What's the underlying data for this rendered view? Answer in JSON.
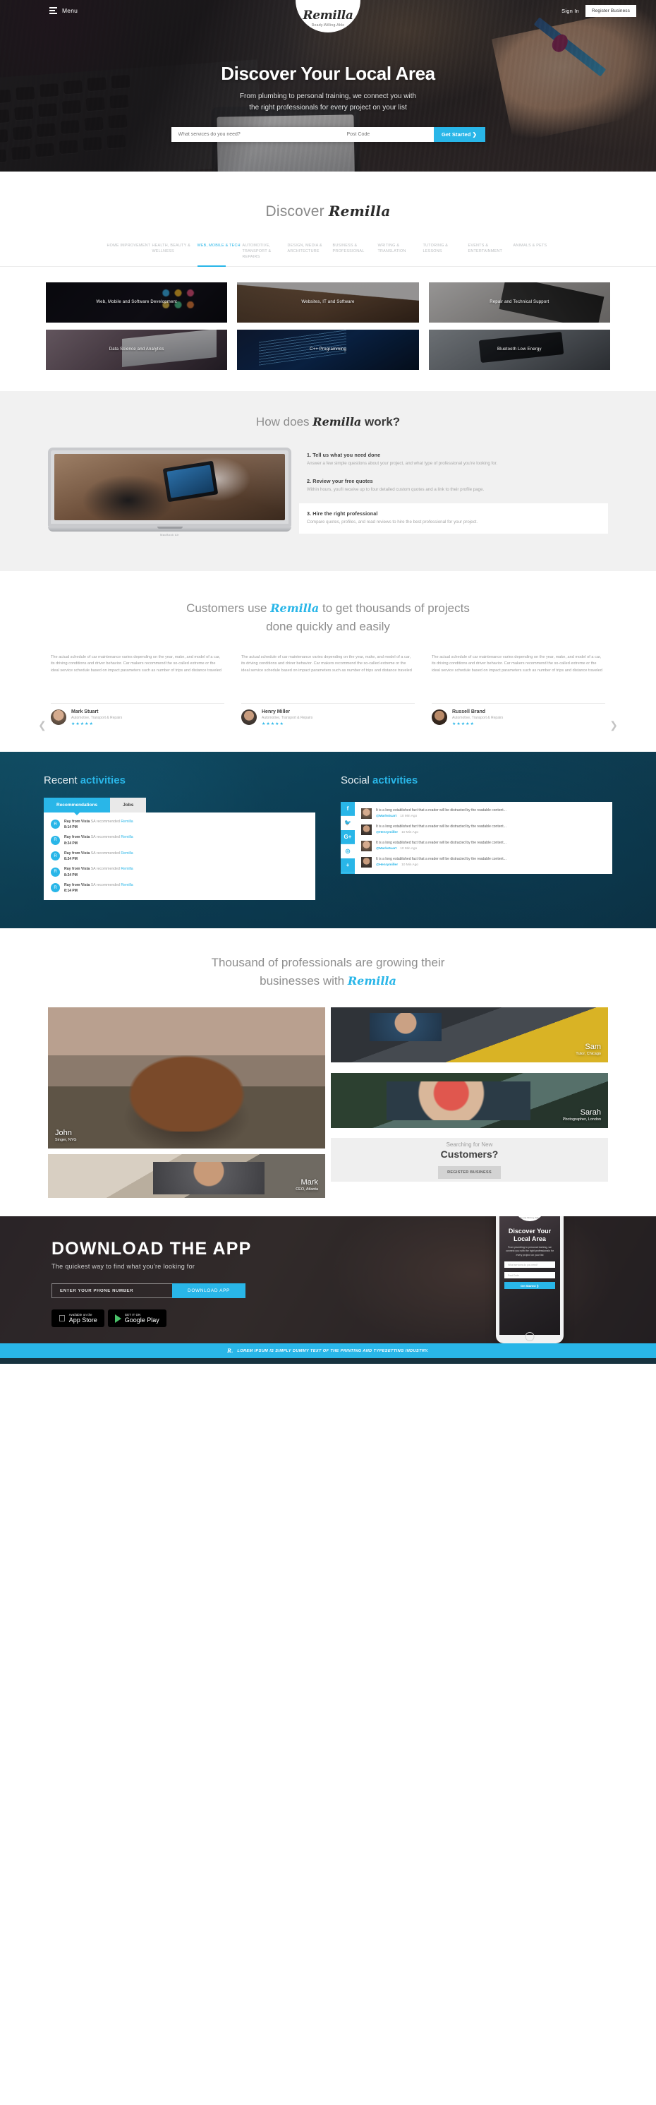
{
  "brand": {
    "name": "Remilla",
    "tagline": "Ready.Willing.Able",
    "accent": "#29b6e8"
  },
  "topbar": {
    "menu_label": "Menu",
    "sign_in": "Sign In",
    "register_business": "Register Business"
  },
  "hero": {
    "title": "Discover Your Local Area",
    "subtitle_line1": "From plumbing to personal training, we connect you with",
    "subtitle_line2": "the right professionals for every project on your list",
    "service_placeholder": "What services do you need?",
    "postcode_placeholder": "Post Code",
    "cta": "Get Started ❯"
  },
  "discover": {
    "title_prefix": "Discover",
    "title_brand": "Remilla",
    "tabs": [
      {
        "label": "HOME IMPROVEMENT",
        "active": false
      },
      {
        "label": "HEALTH, BEAUTY & WELLNESS",
        "active": false
      },
      {
        "label": "WEB, MOBILE & TECH",
        "active": true
      },
      {
        "label": "AUTOMOTIVE, TRANSPORT & REPAIRS",
        "active": false
      },
      {
        "label": "DESIGN, MEDIA & ARCHITECTURE",
        "active": false
      },
      {
        "label": "BUSINESS & PROFESSIONAL",
        "active": false
      },
      {
        "label": "WRITING & TRANSLATION",
        "active": false
      },
      {
        "label": "TUTORING & LESSONS",
        "active": false
      },
      {
        "label": "EVENTS & ENTERTAINMENT",
        "active": false
      },
      {
        "label": "ANIMALS & PETS",
        "active": false
      }
    ],
    "cards": [
      {
        "label": "Web, Mobile and Software Development"
      },
      {
        "label": "Websites, IT and Software"
      },
      {
        "label": "Repair and Technical Support"
      },
      {
        "label": "Data Science and Analytics"
      },
      {
        "label": "C++ Programming"
      },
      {
        "label": "Bluetooth Low Energy"
      }
    ]
  },
  "how": {
    "title_prefix": "How does",
    "title_brand": "Remilla",
    "title_suffix": "work?",
    "laptop_caption": "MacBook Air",
    "steps": [
      {
        "heading": "1. Tell us what you need done",
        "body": "Answer a few simple questions about your project, and what type of professional you're looking for.",
        "highlight": false
      },
      {
        "heading": "2. Review your free quotes",
        "body": "Within hours, you'll receive up to four detailed custom quotes and a link to their profile page.",
        "highlight": false
      },
      {
        "heading": "3. Hire the right professional",
        "body": "Compare quotes, profiles, and read reviews to hire the best professional for your project.",
        "highlight": true
      }
    ]
  },
  "testimonials": {
    "title_prefix": "Customers use",
    "title_brand": "Remilla",
    "title_mid": "to get thousands of projects",
    "title_line2": "done quickly and easily",
    "quote": "The actual schedule of car maintenance varies depending on the year, make, and model of a car, its driving conditions and driver behavior. Car makers recommend the so-called extreme or the ideal service schedule based on impact parameters such as number of trips and distance traveled",
    "items": [
      {
        "name": "Mark Stuart",
        "role": "Automotive, Transport & Repairs",
        "stars": "★★★★★"
      },
      {
        "name": "Henry Miller",
        "role": "Automotive, Transport & Repairs",
        "stars": "★★★★★"
      },
      {
        "name": "Russell Brand",
        "role": "Automotive, Transport & Repairs",
        "stars": "★★★★★"
      }
    ],
    "prev": "❮",
    "next": "❯"
  },
  "activities": {
    "recent": {
      "title_prefix": "Recent",
      "title_accent": "activities",
      "tabs": [
        {
          "label": "Recommendations",
          "active": true
        },
        {
          "label": "Jobs",
          "active": false
        }
      ],
      "rows": [
        {
          "initial": "R",
          "user": "Ray from Vista",
          "action": "SA recommended",
          "target": "Remilla",
          "time": "8:14 PM"
        },
        {
          "initial": "R",
          "user": "Ray from Vista",
          "action": "SA recommended",
          "target": "Remilla",
          "time": "8:24 PM"
        },
        {
          "initial": "R",
          "user": "Ray from Vista",
          "action": "SA recommended",
          "target": "Remilla",
          "time": "8:24 PM"
        },
        {
          "initial": "R",
          "user": "Ray from Vista",
          "action": "SA recommended",
          "target": "Remilla",
          "time": "8:24 PM"
        },
        {
          "initial": "R",
          "user": "Ray from Vista",
          "action": "SA recommended",
          "target": "Remilla",
          "time": "8:14 PM"
        }
      ]
    },
    "social": {
      "title_prefix": "Social",
      "title_accent": "activities",
      "rail": [
        {
          "icon": "facebook-icon",
          "glyph": "f",
          "style": "blue"
        },
        {
          "icon": "twitter-icon",
          "glyph": "🐦",
          "style": "white"
        },
        {
          "icon": "google-plus-icon",
          "glyph": "G+",
          "style": "blue"
        },
        {
          "icon": "instagram-icon",
          "glyph": "◎",
          "style": "white"
        },
        {
          "icon": "plus-icon",
          "glyph": "+",
          "style": "blue"
        }
      ],
      "posts": [
        {
          "text": "It is a long established fact that a reader will be distracted by the readable content...",
          "handle": "@Markstuart",
          "time": "10 Min Ago"
        },
        {
          "text": "It is a long established fact that a reader will be distracted by the readable content...",
          "handle": "@Henrymiller",
          "time": "10 Min Ago"
        },
        {
          "text": "It is a long established fact that a reader will be distracted by the readable content...",
          "handle": "@Markstuart",
          "time": "10 Min Ago"
        },
        {
          "text": "It is a long established fact that a reader will be distracted by the readable content...",
          "handle": "@Henrymiller",
          "time": "10 Min Ago"
        }
      ]
    }
  },
  "pros": {
    "title_line1": "Thousand of professionals are growing their",
    "title_line2_prefix": "businesses with",
    "title_brand": "Remilla",
    "tiles": [
      {
        "name": "John",
        "role": "Singer, NYG"
      },
      {
        "name": "Sam",
        "role": "Tutor, Chicago"
      },
      {
        "name": "Sarah",
        "role": "Photographer, London"
      },
      {
        "name": "Mark",
        "role": "CEO, Atlanta"
      }
    ],
    "cta_box": {
      "line1": "Searching for New",
      "line2": "Customers?",
      "button": "REGISTER BUSINESS"
    }
  },
  "download": {
    "title": "DOWNLOAD THE APP",
    "subtitle": "The quickest way to find what you're looking for",
    "phone_placeholder": "ENTER YOUR PHONE NUMBER",
    "button": "DOWNLOAD APP",
    "appstore": {
      "small": "Available on the",
      "large": "App Store"
    },
    "googleplay": {
      "small": "GET IT ON",
      "large": "Google Play"
    },
    "phone_mock": {
      "title_line1": "Discover Your",
      "title_line2": "Local Area",
      "body": "From plumbing to personal training, we connect you with the right professionals for every project on your list",
      "service_placeholder": "What services do you need?",
      "postcode_placeholder": "Post Code",
      "cta": "Get Started ❯"
    }
  },
  "ticker": {
    "mark": "R.",
    "text": "LOREM IPSUM IS SIMPLY DUMMY TEXT OF THE PRINTING AND TYPESETTING INDUSTRY."
  }
}
